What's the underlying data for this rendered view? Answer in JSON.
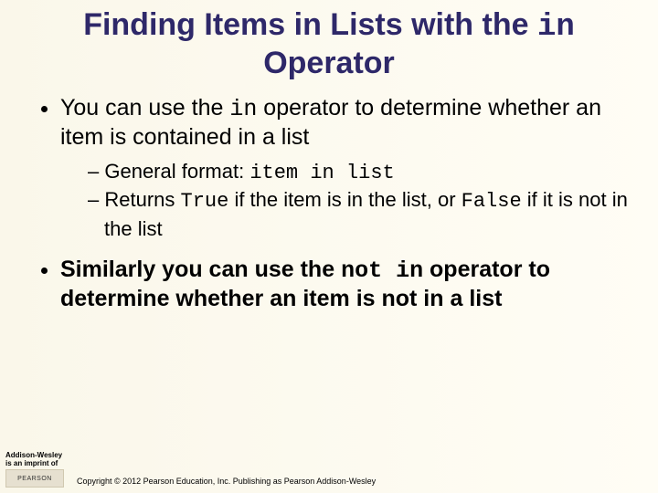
{
  "title": {
    "part1": "Finding Items in Lists with the ",
    "code": "in",
    "part2": " Operator"
  },
  "bullets": [
    {
      "segments": [
        "You can use the ",
        "in",
        " operator to determine whether an item is contained in a list"
      ],
      "sub": [
        {
          "segments": [
            "General format: ",
            "item in list"
          ]
        },
        {
          "segments": [
            "Returns ",
            "True",
            " if the item is in the list, or ",
            "False",
            " if it is not in the list"
          ]
        }
      ]
    },
    {
      "segments": [
        "Similarly you can use the ",
        "not in",
        " operator to determine whether an item is not in a list"
      ],
      "bold": true
    }
  ],
  "footer": {
    "imprint_line1": "Addison-Wesley",
    "imprint_line2": "is an imprint of",
    "logo_text": "PEARSON",
    "copyright": "Copyright © 2012 Pearson Education, Inc. Publishing as Pearson Addison-Wesley"
  }
}
